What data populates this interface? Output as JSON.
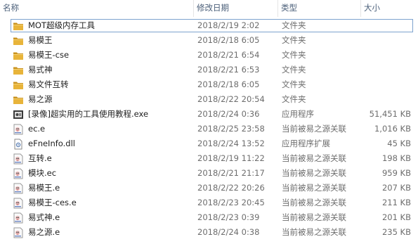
{
  "columns": {
    "name": "名称",
    "date": "修改日期",
    "type": "类型",
    "size": "大小"
  },
  "files": [
    {
      "name": "MOT超级内存工具",
      "date": "2018/2/19 2:02",
      "type": "文件夹",
      "size": "",
      "icon": "folder-icon",
      "focused": true
    },
    {
      "name": "易模王",
      "date": "2018/2/18 6:05",
      "type": "文件夹",
      "size": "",
      "icon": "folder-icon"
    },
    {
      "name": "易模王-cse",
      "date": "2018/2/21 6:54",
      "type": "文件夹",
      "size": "",
      "icon": "folder-icon"
    },
    {
      "name": "易式神",
      "date": "2018/2/21 6:53",
      "type": "文件夹",
      "size": "",
      "icon": "folder-icon"
    },
    {
      "name": "易文件互转",
      "date": "2018/2/18 6:05",
      "type": "文件夹",
      "size": "",
      "icon": "folder-icon"
    },
    {
      "name": "易之源",
      "date": "2018/2/22 20:54",
      "type": "文件夹",
      "size": "",
      "icon": "folder-icon"
    },
    {
      "name": "[录像]超实用的工具使用教程.exe",
      "date": "2018/2/24 0:36",
      "type": "应用程序",
      "size": "51,451 KB",
      "icon": "video-exe-icon"
    },
    {
      "name": "ec.e",
      "date": "2018/2/25 23:58",
      "type": "当前被易之源关联",
      "size": "1,016 KB",
      "icon": "e-file-icon"
    },
    {
      "name": "eFneInfo.dll",
      "date": "2018/2/24 13:52",
      "type": "应用程序扩展",
      "size": "45 KB",
      "icon": "dll-icon"
    },
    {
      "name": "互转.e",
      "date": "2018/2/19 11:22",
      "type": "当前被易之源关联",
      "size": "198 KB",
      "icon": "e-file-icon"
    },
    {
      "name": "模块.ec",
      "date": "2018/2/21 21:17",
      "type": "当前被易之源关联",
      "size": "959 KB",
      "icon": "e-file-icon"
    },
    {
      "name": "易模王.e",
      "date": "2018/2/22 20:26",
      "type": "当前被易之源关联",
      "size": "207 KB",
      "icon": "e-file-icon"
    },
    {
      "name": "易模王-ces.e",
      "date": "2018/2/23 20:45",
      "type": "当前被易之源关联",
      "size": "211 KB",
      "icon": "e-file-icon"
    },
    {
      "name": "易式神.e",
      "date": "2018/2/23 0:39",
      "type": "当前被易之源关联",
      "size": "201 KB",
      "icon": "e-file-icon"
    },
    {
      "name": "易之源.e",
      "date": "2018/2/24 0:38",
      "type": "当前被易之源关联",
      "size": "235 KB",
      "icon": "e-file-icon"
    }
  ],
  "colors": {
    "folder": "#e8b43a",
    "folderDark": "#c9921e",
    "headerText": "#4c607a",
    "focus": "#7da2ce"
  }
}
